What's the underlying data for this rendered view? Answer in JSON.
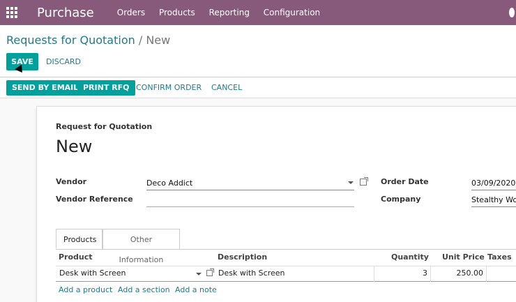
{
  "navbar": {
    "app_name": "Purchase",
    "menu": [
      "Orders",
      "Products",
      "Reporting",
      "Configuration"
    ]
  },
  "breadcrumb": {
    "parent": "Requests for Quotation",
    "separator": "/",
    "current": "New"
  },
  "buttons": {
    "save": "SAVE",
    "discard": "DISCARD"
  },
  "statusbar": {
    "send_email": "SEND BY EMAIL",
    "print_rfq": "PRINT RFQ",
    "confirm": "CONFIRM ORDER",
    "cancel": "CANCEL"
  },
  "form": {
    "doc_type": "Request for Quotation",
    "name": "New",
    "vendor_label": "Vendor",
    "vendor_value": "Deco Addict",
    "vendor_ref_label": "Vendor Reference",
    "vendor_ref_value": "",
    "order_date_label": "Order Date",
    "order_date_value": "03/09/2020",
    "company_label": "Company",
    "company_value": "Stealthy Woo"
  },
  "tabs": [
    "Products",
    "Other Information"
  ],
  "table": {
    "headers": {
      "product": "Product",
      "description": "Description",
      "quantity": "Quantity",
      "unit_price": "Unit Price",
      "taxes": "Taxes"
    },
    "row": {
      "product": "Desk with Screen",
      "description": "Desk with Screen",
      "quantity": "3",
      "unit_price": "250.00"
    },
    "add_product": "Add a product",
    "add_section": "Add a section",
    "add_note": "Add a note"
  },
  "colors": {
    "navbar": "#875a7b",
    "primary": "#00a09d",
    "link": "#1f7b8a"
  }
}
